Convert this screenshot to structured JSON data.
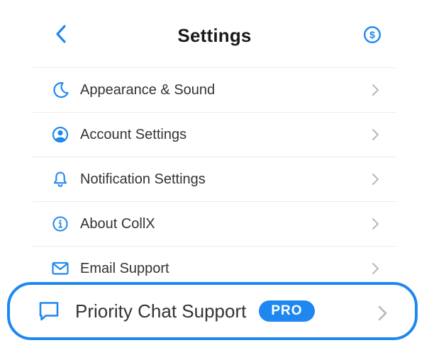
{
  "header": {
    "title": "Settings",
    "back_icon": "chevron-left-icon",
    "right_icon": "dollar-circle-icon"
  },
  "menu": {
    "items": [
      {
        "label": "Appearance & Sound",
        "icon": "moon-icon"
      },
      {
        "label": "Account Settings",
        "icon": "user-circle-icon"
      },
      {
        "label": "Notification Settings",
        "icon": "bell-icon"
      },
      {
        "label": "About CollX",
        "icon": "info-circle-icon"
      },
      {
        "label": "Email Support",
        "icon": "envelope-icon"
      }
    ]
  },
  "priority": {
    "label": "Priority Chat Support",
    "badge": "PRO",
    "icon": "chat-bubble-icon"
  },
  "colors": {
    "accent": "#1e88f0",
    "text": "#333333",
    "chevron": "#b8b8b8",
    "divider": "#ececec"
  }
}
